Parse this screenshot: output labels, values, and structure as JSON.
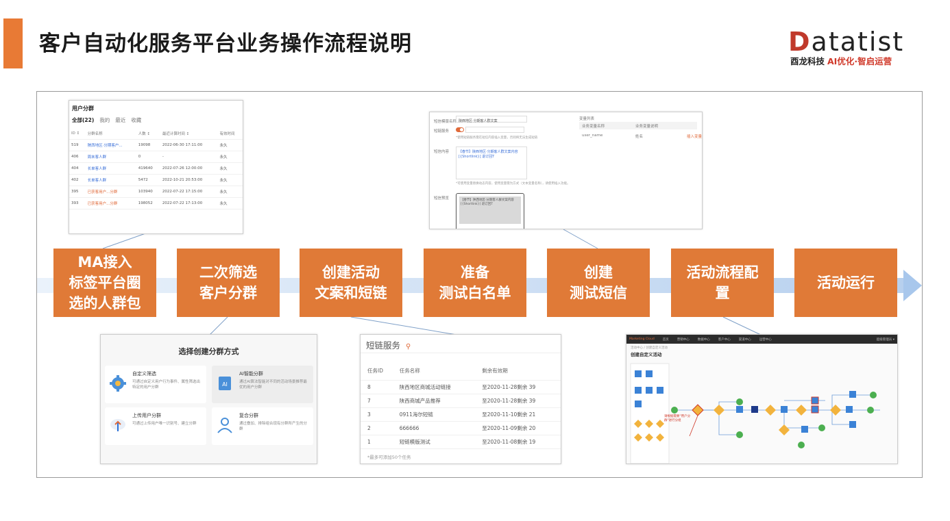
{
  "page": {
    "title": "客户自动化服务平台业务操作流程说明"
  },
  "logo": {
    "brand_first": "D",
    "brand_rest": "atatist",
    "tagline_company": "酉龙科技",
    "tagline_slogan": "AI优化·智启运营"
  },
  "steps": [
    {
      "lines": [
        "MA接入",
        "标签平台圈",
        "选的人群包"
      ]
    },
    {
      "lines": [
        "二次筛选",
        "客户分群"
      ]
    },
    {
      "lines": [
        "创建活动",
        "文案和短链"
      ]
    },
    {
      "lines": [
        "准备",
        "测试白名单"
      ]
    },
    {
      "lines": [
        "创建",
        "测试短信"
      ]
    },
    {
      "lines": [
        "活动流程配",
        "置"
      ]
    },
    {
      "lines": [
        "活动运行"
      ]
    }
  ],
  "user_groups": {
    "title": "用户分群",
    "tabs": [
      "全部(22)",
      "我的",
      "最近",
      "收藏"
    ],
    "columns": [
      "ID ↕",
      "分群名称",
      "人数 ↕",
      "最近计算时间 ↕",
      "有效时间"
    ],
    "rows": [
      {
        "id": "519",
        "name": "陕西地区·分期客户...",
        "count": "19098",
        "time": "2022-06-30 17:11:00",
        "valid": "永久",
        "warn": false
      },
      {
        "id": "406",
        "name": "周末客人群",
        "count": "0",
        "time": "-",
        "valid": "永久",
        "warn": false
      },
      {
        "id": "404",
        "name": "长单客人群",
        "count": "419640",
        "time": "2022-07-26 12:00:00",
        "valid": "永久",
        "warn": false
      },
      {
        "id": "402",
        "name": "长单客人群",
        "count": "5472",
        "time": "2022-10-21 20:53:00",
        "valid": "永久",
        "warn": false
      },
      {
        "id": "395",
        "name": "已获客用户...分群",
        "count": "103940",
        "time": "2022-07-22 17:15:00",
        "valid": "永久",
        "warn": true
      },
      {
        "id": "393",
        "name": "已获客用户...分群",
        "count": "198052",
        "time": "2022-07-22 17:13:00",
        "valid": "永久",
        "warn": true
      }
    ]
  },
  "segment_method": {
    "title": "选择创建分群方式",
    "options": [
      {
        "name": "自定义筛选",
        "desc": "可通过自定义用户行为事件、属性筛选出特定的用户分群"
      },
      {
        "name": "AI智能分群",
        "desc": "通过AI算法智能对不同的活动场景推荐最优的用户分群"
      },
      {
        "name": "上传用户分群",
        "desc": "可通过上传用户唯一识别号、建立分群"
      },
      {
        "name": "复合分群",
        "desc": "通过叠加、排除组合现有分群所产生的分群"
      }
    ]
  },
  "sms_form": {
    "label_name": "短信模版名称",
    "value_name": "陕西地区·分期客人群文案",
    "label_switch": "短链服务",
    "switch_note": "*使用短链服务需在短信内容插入变量，否则将无法生成短链",
    "label_content": "短信内容",
    "value_content": "【春节】陕西地区·分期客人群文案内容 [{Shortlink}] 退订回T",
    "content_note": "*可使用变量替换动态内容，使用变量需为方式（文本变量名称），请使用插入功能。",
    "label_preview": "短信预览",
    "value_preview": "【春节】陕西地区·分期客人群文案内容 [{Shortlink}] 退订回T",
    "var_list_title": "变量列表",
    "var_col_name": "业务变量名称",
    "var_col_desc": "业务变量说明",
    "var_row_name": "user_name",
    "var_row_desc": "姓名",
    "var_insert": "插入变量"
  },
  "short_link": {
    "title": "短链服务",
    "columns": [
      "任务ID",
      "任务名称",
      "剩余有效期"
    ],
    "rows": [
      {
        "id": "8",
        "name": "陕西地区商城活动链接",
        "remain": "至2020-11-28剩余 39"
      },
      {
        "id": "7",
        "name": "陕西商城产品推荐",
        "remain": "至2020-11-28剩余 39"
      },
      {
        "id": "3",
        "name": "0911海尔短链",
        "remain": "至2020-11-10剩余 21"
      },
      {
        "id": "2",
        "name": "666666",
        "remain": "至2020-11-09剩余 20"
      },
      {
        "id": "1",
        "name": "短链模版测试",
        "remain": "至2020-11-08剩余 19"
      }
    ],
    "footer": "*最多可添加50个任务"
  },
  "flow_editor": {
    "brand": "Marketing Cloud",
    "nav": [
      "首页",
      "营销中心",
      "数据中心",
      "客户中心",
      "渠道中心",
      "运营中心"
    ],
    "user": "超级管理员 ▾",
    "breadcrumb": "活动中心 / 创建自定义活动",
    "title": "创建自定义活动",
    "annotation": "请根据需要\"用户分群\"进行分组"
  },
  "colors": {
    "accent": "#e07a37",
    "arrow": "#a8c7ec",
    "brand_red": "#c0392b"
  }
}
